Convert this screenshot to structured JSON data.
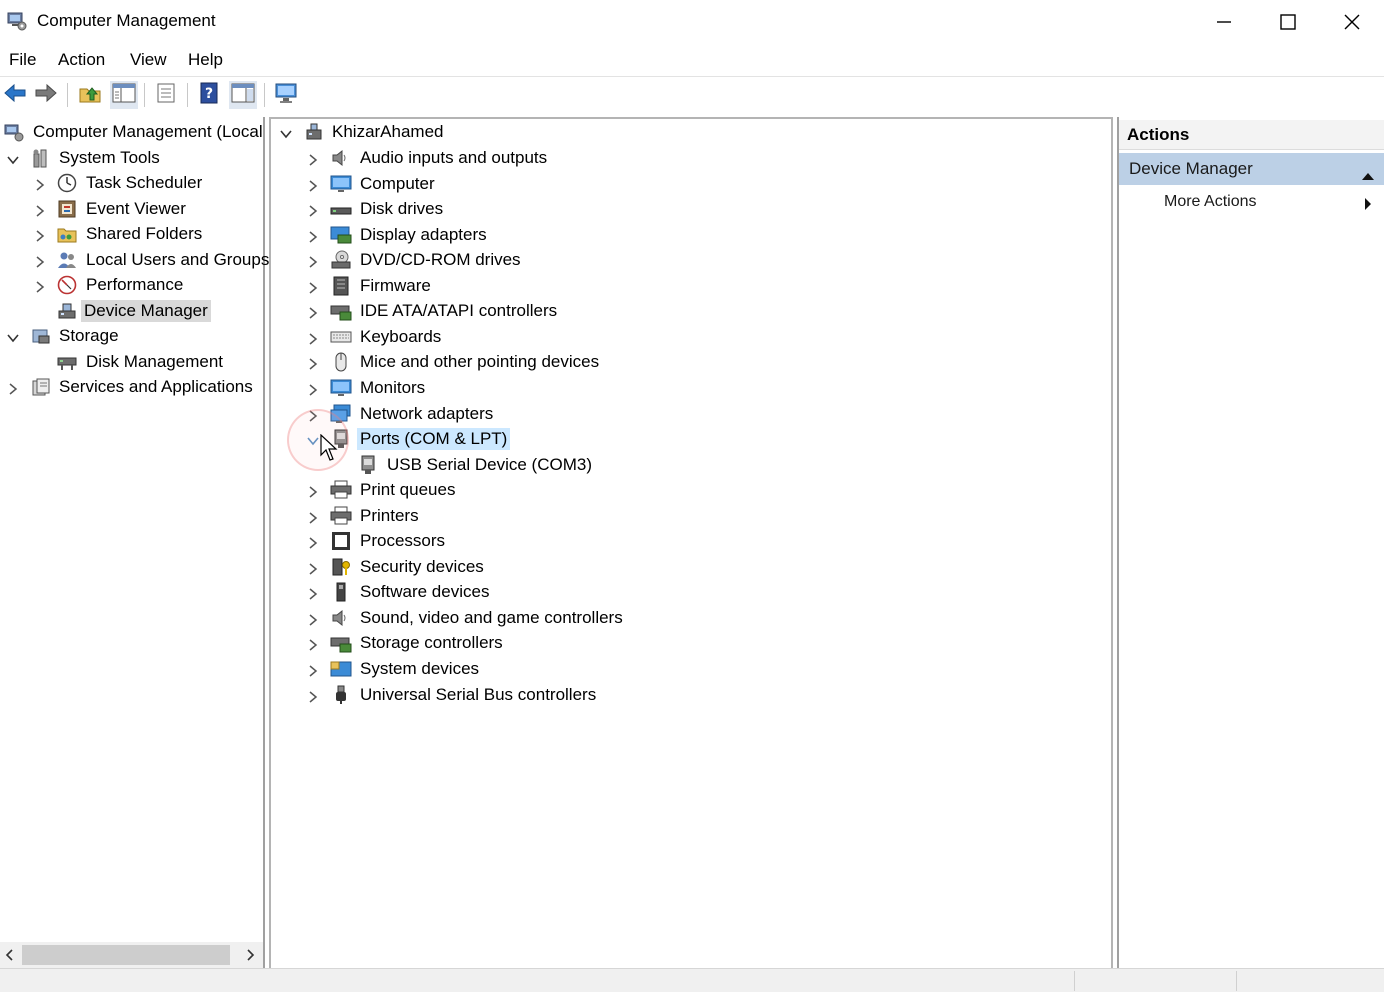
{
  "window": {
    "title": "Computer Management",
    "app_icon": "computer-management-icon",
    "controls": [
      "minimize-icon",
      "maximize-icon",
      "close-icon"
    ]
  },
  "menu": {
    "items": [
      "File",
      "Action",
      "View",
      "Help"
    ]
  },
  "toolbar": {
    "buttons": [
      "back-arrow-icon",
      "forward-arrow-icon",
      "up-folder-icon",
      "show-hide-console-tree-icon",
      "properties-icon",
      "help-icon",
      "show-hide-action-pane-icon",
      "monitor-icon"
    ]
  },
  "left_tree": {
    "root": "Computer Management (Local",
    "system_tools": "System Tools",
    "task_scheduler": "Task Scheduler",
    "event_viewer": "Event Viewer",
    "shared_folders": "Shared Folders",
    "local_users": "Local Users and Groups",
    "performance": "Performance",
    "device_manager": "Device Manager",
    "storage": "Storage",
    "disk_management": "Disk Management",
    "services_apps": "Services and Applications"
  },
  "device_tree": {
    "root": "KhizarAhamed",
    "categories": [
      "Audio inputs and outputs",
      "Computer",
      "Disk drives",
      "Display adapters",
      "DVD/CD-ROM drives",
      "Firmware",
      "IDE ATA/ATAPI controllers",
      "Keyboards",
      "Mice and other pointing devices",
      "Monitors",
      "Network adapters",
      "Ports (COM & LPT)",
      "Print queues",
      "Printers",
      "Processors",
      "Security devices",
      "Software devices",
      "Sound, video and game controllers",
      "Storage controllers",
      "System devices",
      "Universal Serial Bus controllers"
    ],
    "ports_child": "USB Serial Device (COM3)"
  },
  "actions": {
    "header": "Actions",
    "section": "Device Manager",
    "more_actions": "More Actions"
  },
  "colors": {
    "selection_focus": "#cce8ff",
    "selection_inactive": "#d9d9d9",
    "actions_section_bg": "#bcd0e6"
  }
}
